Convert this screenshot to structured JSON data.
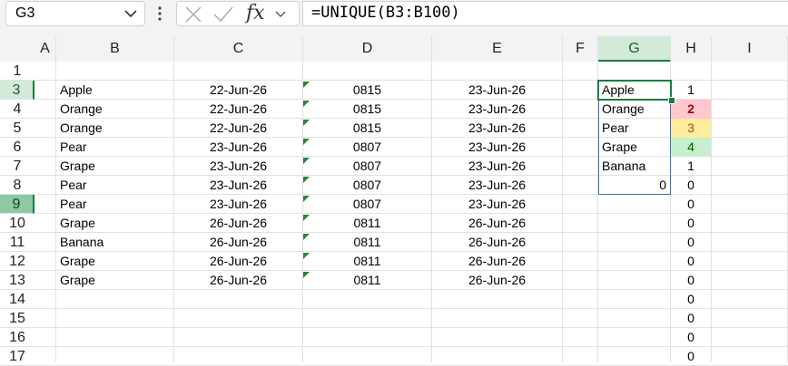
{
  "name_box": {
    "value": "G3"
  },
  "formula_bar": {
    "formula": "=UNIQUE(B3:B100)"
  },
  "columns": [
    "A",
    "B",
    "C",
    "D",
    "E",
    "F",
    "G",
    "H",
    "I"
  ],
  "selected_column": "G",
  "rows": [
    {
      "n": "1",
      "b": "",
      "c": "",
      "d": "",
      "e": "",
      "g": "",
      "h": "",
      "tri": false
    },
    {
      "n": "3",
      "b": "Apple",
      "c": "22-Jun-26",
      "d": "0815",
      "e": "23-Jun-26",
      "g": "Apple",
      "h": "1",
      "tri": true
    },
    {
      "n": "4",
      "b": "Orange",
      "c": "22-Jun-26",
      "d": "0815",
      "e": "23-Jun-26",
      "g": "Orange",
      "h": "2",
      "tri": true
    },
    {
      "n": "5",
      "b": "Orange",
      "c": "22-Jun-26",
      "d": "0815",
      "e": "23-Jun-26",
      "g": "Pear",
      "h": "3",
      "tri": true
    },
    {
      "n": "6",
      "b": "Pear",
      "c": "23-Jun-26",
      "d": "0807",
      "e": "23-Jun-26",
      "g": "Grape",
      "h": "4",
      "tri": true
    },
    {
      "n": "7",
      "b": "Grape",
      "c": "23-Jun-26",
      "d": "0807",
      "e": "23-Jun-26",
      "g": "Banana",
      "h": "1",
      "tri": true
    },
    {
      "n": "8",
      "b": "Pear",
      "c": "23-Jun-26",
      "d": "0807",
      "e": "23-Jun-26",
      "g": "0",
      "h": "0",
      "tri": true
    },
    {
      "n": "9",
      "b": "Pear",
      "c": "23-Jun-26",
      "d": "0807",
      "e": "23-Jun-26",
      "g": "",
      "h": "0",
      "tri": true
    },
    {
      "n": "10",
      "b": "Grape",
      "c": "26-Jun-26",
      "d": "0811",
      "e": "26-Jun-26",
      "g": "",
      "h": "0",
      "tri": true
    },
    {
      "n": "11",
      "b": "Banana",
      "c": "26-Jun-26",
      "d": "0811",
      "e": "26-Jun-26",
      "g": "",
      "h": "0",
      "tri": true
    },
    {
      "n": "12",
      "b": "Grape",
      "c": "26-Jun-26",
      "d": "0811",
      "e": "26-Jun-26",
      "g": "",
      "h": "0",
      "tri": true
    },
    {
      "n": "13",
      "b": "Grape",
      "c": "26-Jun-26",
      "d": "0811",
      "e": "26-Jun-26",
      "g": "",
      "h": "0",
      "tri": true
    },
    {
      "n": "14",
      "b": "",
      "c": "",
      "d": "",
      "e": "",
      "g": "",
      "h": "0",
      "tri": false
    },
    {
      "n": "15",
      "b": "",
      "c": "",
      "d": "",
      "e": "",
      "g": "",
      "h": "0",
      "tri": false
    },
    {
      "n": "16",
      "b": "",
      "c": "",
      "d": "",
      "e": "",
      "g": "",
      "h": "0",
      "tri": false
    },
    {
      "n": "17",
      "b": "",
      "c": "",
      "d": "",
      "e": "",
      "g": "",
      "h": "0",
      "tri": false
    }
  ],
  "highlight_colors": {
    "red": "#ffc7ce",
    "yellow": "#ffeb9c",
    "green": "#c6efce",
    "selection": "#137e43"
  }
}
